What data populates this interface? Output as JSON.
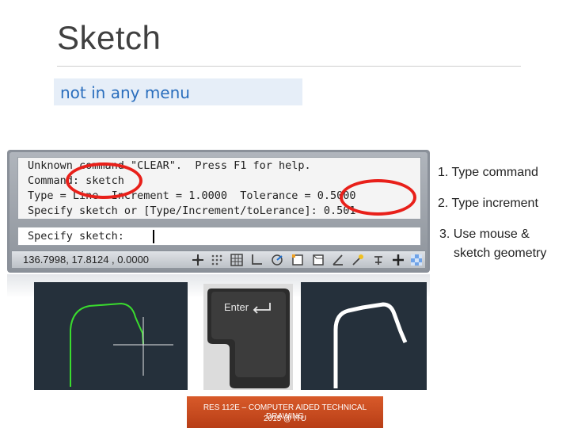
{
  "slide": {
    "title": "Sketch",
    "highlight": "not in any menu"
  },
  "command_window": {
    "history": [
      "Unknown command \"CLEAR\".  Press F1 for help.",
      "Command: sketch",
      "Type = Line  Increment = 1.0000  Tolerance = 0.5000",
      "Specify sketch or [Type/Increment/toLerance]: 0.501"
    ],
    "prompt": "Specify sketch:",
    "coordinates": "136.7998, 17.8124 , 0.0000"
  },
  "steps": [
    "1. Type command",
    "2. Type increment",
    "3. Use mouse &",
    "sketch geometry"
  ],
  "key_label": "Enter",
  "footer": {
    "line1": "RES 112E – COMPUTER AIDED TECHNICAL DRAWING",
    "line2": "2015 @ ITU"
  },
  "colors": {
    "accent_red": "#e8201a",
    "highlight_text": "#2a6ebd",
    "footer_orange": "#c9461c",
    "sketch_green": "#3adc2e",
    "panel_dark": "#25303b"
  }
}
